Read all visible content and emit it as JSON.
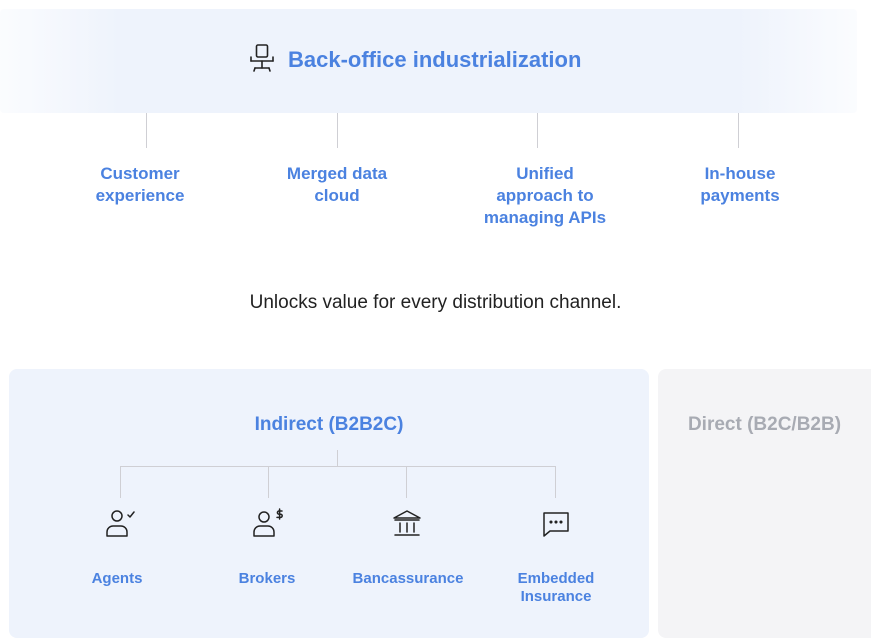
{
  "banner": {
    "title": "Back-office industrialization",
    "icon": "office-chair-icon"
  },
  "pillars": [
    "Customer\nexperience",
    "Merged data\ncloud",
    "Unified\napproach to\nmanaging APIs",
    "In-house\npayments"
  ],
  "tagline": "Unlocks value for every distribution channel.",
  "panels": {
    "indirect": {
      "title": "Indirect (B2B2C)"
    },
    "direct": {
      "title": "Direct (B2C/B2B)"
    }
  },
  "channels": [
    {
      "label": "Agents",
      "icon": "agent-check-icon"
    },
    {
      "label": "Brokers",
      "icon": "broker-dollar-icon"
    },
    {
      "label": "Bancassurance",
      "icon": "bank-icon"
    },
    {
      "label": "Embedded\nInsurance",
      "icon": "chat-bubble-icon"
    }
  ],
  "colors": {
    "accent": "#4b82e0",
    "banner_bg": "#eef3fc",
    "muted_title": "#a8abb3",
    "line": "#cfcfd4"
  }
}
